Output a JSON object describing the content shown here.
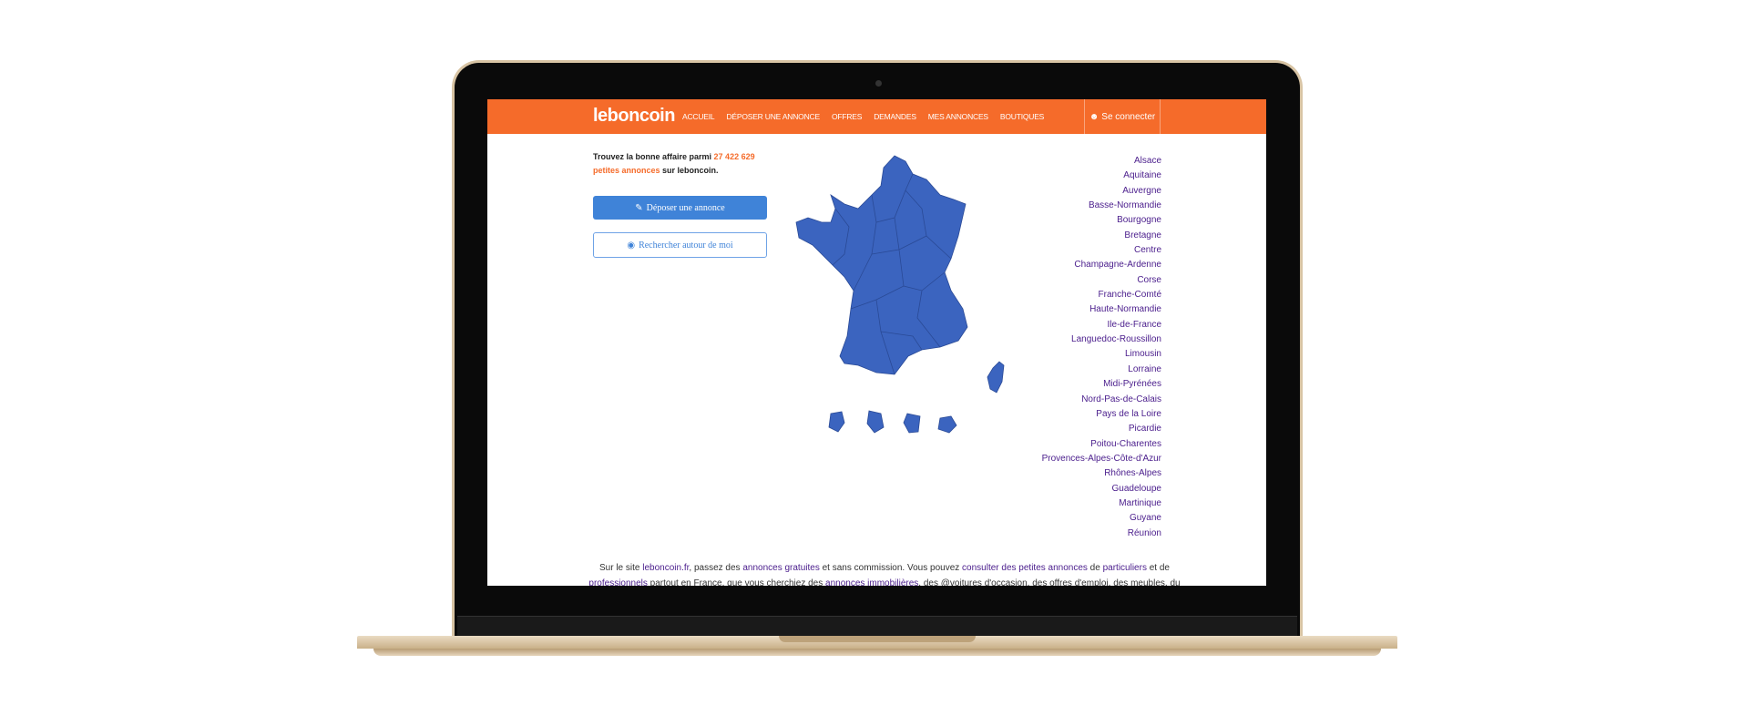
{
  "header": {
    "logo": "leboncoin",
    "nav": [
      "ACCUEIL",
      "DÉPOSER UNE ANNONCE",
      "OFFRES",
      "DEMANDES",
      "MES ANNONCES",
      "BOUTIQUES"
    ],
    "login": "Se connecter"
  },
  "intro": {
    "prefix": "Trouvez la bonne affaire parmi ",
    "count": "27 422 629 petites annonces",
    "suffix": " sur leboncoin."
  },
  "buttons": {
    "post": "Déposer une annonce",
    "search_near": "Rechercher autour de moi"
  },
  "regions": [
    "Alsace",
    "Aquitaine",
    "Auvergne",
    "Basse-Normandie",
    "Bourgogne",
    "Bretagne",
    "Centre",
    "Champagne-Ardenne",
    "Corse",
    "Franche-Comté",
    "Haute-Normandie",
    "Ile-de-France",
    "Languedoc-Roussillon",
    "Limousin",
    "Lorraine",
    "Midi-Pyrénées",
    "Nord-Pas-de-Calais",
    "Pays de la Loire",
    "Picardie",
    "Poitou-Charentes",
    "Provences-Alpes-Côte-d'Azur",
    "Rhônes-Alpes",
    "Guadeloupe",
    "Martinique",
    "Guyane",
    "Réunion"
  ],
  "footer": {
    "t1": "Sur le site ",
    "l1": "leboncoin.fr",
    "t2": ", passez des ",
    "l2": "annonces gratuites",
    "t3": " et sans commission. Vous pouvez ",
    "l3": "consulter des petites annonces",
    "t4": " de ",
    "l4": "particuliers",
    "t5": " et de ",
    "l5": "professionnels",
    "t6": " partout en France, que vous cherchiez des ",
    "l6": "annonces immobilières",
    "t7": ", des @voitures d'occasion, des offres d'emploi, des meubles, du"
  },
  "colors": {
    "brand": "#f56b2a",
    "map": "#3b64bf",
    "link": "#4a1d8c"
  }
}
